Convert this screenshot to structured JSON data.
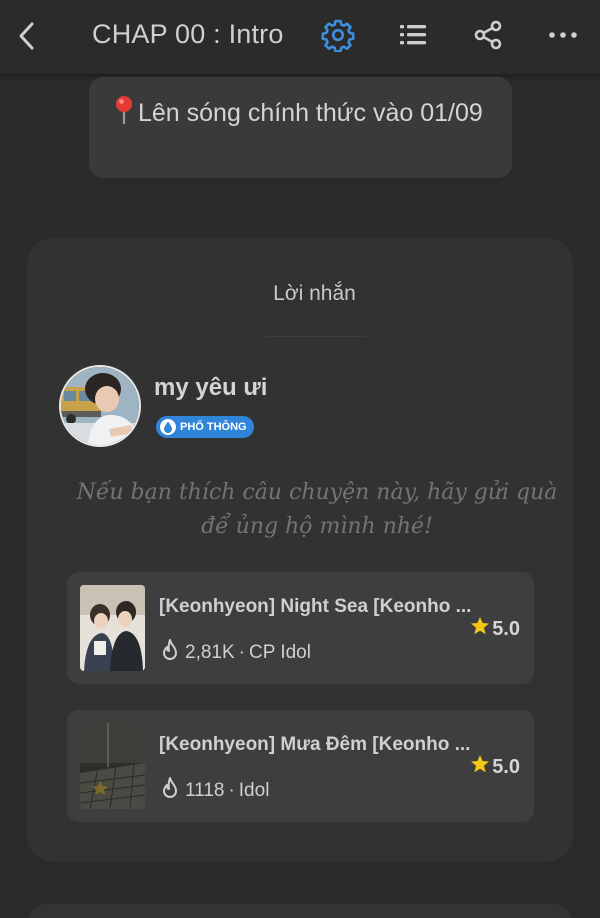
{
  "header": {
    "title": "CHAP 00 : Intro",
    "accent_color": "#3d8fe0",
    "icons": [
      "back-arrow-icon",
      "settings-gear-icon",
      "list-icon",
      "share-icon",
      "more-icon"
    ]
  },
  "notice": {
    "icon": "pin-icon",
    "text": "Lên sóng chính thức vào 01/09"
  },
  "author_note": {
    "heading": "Lời nhắn",
    "author_name": "my yêu ưi",
    "badge_label": "PHỔ THÔNG",
    "badge_color": "#2f86d9",
    "message": "Nếu bạn thích câu chuyện này, hãy gửi quà để ủng hộ mình nhé!"
  },
  "stories": [
    {
      "title": "[Keonhyeon] Night Sea [Keonho ...",
      "reads": "2,81K",
      "category": "CP Idol",
      "rating": "5.0"
    },
    {
      "title": "[Keonhyeon] Mưa Đêm [Keonho ...",
      "reads": "1118",
      "category": "Idol",
      "rating": "5.0"
    }
  ]
}
